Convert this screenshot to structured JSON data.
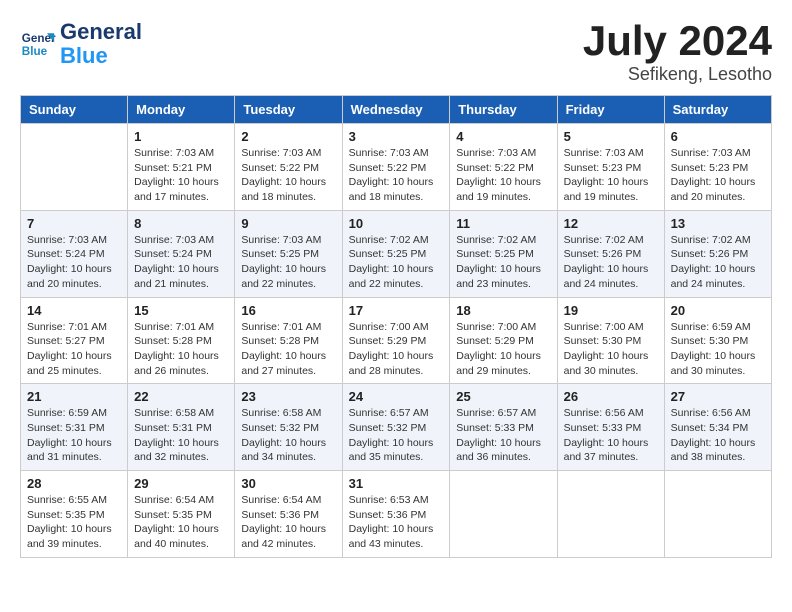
{
  "logo": {
    "name": "General",
    "name2": "Blue"
  },
  "header": {
    "month": "July 2024",
    "location": "Sefikeng, Lesotho"
  },
  "columns": [
    "Sunday",
    "Monday",
    "Tuesday",
    "Wednesday",
    "Thursday",
    "Friday",
    "Saturday"
  ],
  "weeks": [
    [
      {
        "day": "",
        "sunrise": "",
        "sunset": "",
        "daylight": ""
      },
      {
        "day": "1",
        "sunrise": "Sunrise: 7:03 AM",
        "sunset": "Sunset: 5:21 PM",
        "daylight": "Daylight: 10 hours and 17 minutes."
      },
      {
        "day": "2",
        "sunrise": "Sunrise: 7:03 AM",
        "sunset": "Sunset: 5:22 PM",
        "daylight": "Daylight: 10 hours and 18 minutes."
      },
      {
        "day": "3",
        "sunrise": "Sunrise: 7:03 AM",
        "sunset": "Sunset: 5:22 PM",
        "daylight": "Daylight: 10 hours and 18 minutes."
      },
      {
        "day": "4",
        "sunrise": "Sunrise: 7:03 AM",
        "sunset": "Sunset: 5:22 PM",
        "daylight": "Daylight: 10 hours and 19 minutes."
      },
      {
        "day": "5",
        "sunrise": "Sunrise: 7:03 AM",
        "sunset": "Sunset: 5:23 PM",
        "daylight": "Daylight: 10 hours and 19 minutes."
      },
      {
        "day": "6",
        "sunrise": "Sunrise: 7:03 AM",
        "sunset": "Sunset: 5:23 PM",
        "daylight": "Daylight: 10 hours and 20 minutes."
      }
    ],
    [
      {
        "day": "7",
        "sunrise": "Sunrise: 7:03 AM",
        "sunset": "Sunset: 5:24 PM",
        "daylight": "Daylight: 10 hours and 20 minutes."
      },
      {
        "day": "8",
        "sunrise": "Sunrise: 7:03 AM",
        "sunset": "Sunset: 5:24 PM",
        "daylight": "Daylight: 10 hours and 21 minutes."
      },
      {
        "day": "9",
        "sunrise": "Sunrise: 7:03 AM",
        "sunset": "Sunset: 5:25 PM",
        "daylight": "Daylight: 10 hours and 22 minutes."
      },
      {
        "day": "10",
        "sunrise": "Sunrise: 7:02 AM",
        "sunset": "Sunset: 5:25 PM",
        "daylight": "Daylight: 10 hours and 22 minutes."
      },
      {
        "day": "11",
        "sunrise": "Sunrise: 7:02 AM",
        "sunset": "Sunset: 5:25 PM",
        "daylight": "Daylight: 10 hours and 23 minutes."
      },
      {
        "day": "12",
        "sunrise": "Sunrise: 7:02 AM",
        "sunset": "Sunset: 5:26 PM",
        "daylight": "Daylight: 10 hours and 24 minutes."
      },
      {
        "day": "13",
        "sunrise": "Sunrise: 7:02 AM",
        "sunset": "Sunset: 5:26 PM",
        "daylight": "Daylight: 10 hours and 24 minutes."
      }
    ],
    [
      {
        "day": "14",
        "sunrise": "Sunrise: 7:01 AM",
        "sunset": "Sunset: 5:27 PM",
        "daylight": "Daylight: 10 hours and 25 minutes."
      },
      {
        "day": "15",
        "sunrise": "Sunrise: 7:01 AM",
        "sunset": "Sunset: 5:28 PM",
        "daylight": "Daylight: 10 hours and 26 minutes."
      },
      {
        "day": "16",
        "sunrise": "Sunrise: 7:01 AM",
        "sunset": "Sunset: 5:28 PM",
        "daylight": "Daylight: 10 hours and 27 minutes."
      },
      {
        "day": "17",
        "sunrise": "Sunrise: 7:00 AM",
        "sunset": "Sunset: 5:29 PM",
        "daylight": "Daylight: 10 hours and 28 minutes."
      },
      {
        "day": "18",
        "sunrise": "Sunrise: 7:00 AM",
        "sunset": "Sunset: 5:29 PM",
        "daylight": "Daylight: 10 hours and 29 minutes."
      },
      {
        "day": "19",
        "sunrise": "Sunrise: 7:00 AM",
        "sunset": "Sunset: 5:30 PM",
        "daylight": "Daylight: 10 hours and 30 minutes."
      },
      {
        "day": "20",
        "sunrise": "Sunrise: 6:59 AM",
        "sunset": "Sunset: 5:30 PM",
        "daylight": "Daylight: 10 hours and 30 minutes."
      }
    ],
    [
      {
        "day": "21",
        "sunrise": "Sunrise: 6:59 AM",
        "sunset": "Sunset: 5:31 PM",
        "daylight": "Daylight: 10 hours and 31 minutes."
      },
      {
        "day": "22",
        "sunrise": "Sunrise: 6:58 AM",
        "sunset": "Sunset: 5:31 PM",
        "daylight": "Daylight: 10 hours and 32 minutes."
      },
      {
        "day": "23",
        "sunrise": "Sunrise: 6:58 AM",
        "sunset": "Sunset: 5:32 PM",
        "daylight": "Daylight: 10 hours and 34 minutes."
      },
      {
        "day": "24",
        "sunrise": "Sunrise: 6:57 AM",
        "sunset": "Sunset: 5:32 PM",
        "daylight": "Daylight: 10 hours and 35 minutes."
      },
      {
        "day": "25",
        "sunrise": "Sunrise: 6:57 AM",
        "sunset": "Sunset: 5:33 PM",
        "daylight": "Daylight: 10 hours and 36 minutes."
      },
      {
        "day": "26",
        "sunrise": "Sunrise: 6:56 AM",
        "sunset": "Sunset: 5:33 PM",
        "daylight": "Daylight: 10 hours and 37 minutes."
      },
      {
        "day": "27",
        "sunrise": "Sunrise: 6:56 AM",
        "sunset": "Sunset: 5:34 PM",
        "daylight": "Daylight: 10 hours and 38 minutes."
      }
    ],
    [
      {
        "day": "28",
        "sunrise": "Sunrise: 6:55 AM",
        "sunset": "Sunset: 5:35 PM",
        "daylight": "Daylight: 10 hours and 39 minutes."
      },
      {
        "day": "29",
        "sunrise": "Sunrise: 6:54 AM",
        "sunset": "Sunset: 5:35 PM",
        "daylight": "Daylight: 10 hours and 40 minutes."
      },
      {
        "day": "30",
        "sunrise": "Sunrise: 6:54 AM",
        "sunset": "Sunset: 5:36 PM",
        "daylight": "Daylight: 10 hours and 42 minutes."
      },
      {
        "day": "31",
        "sunrise": "Sunrise: 6:53 AM",
        "sunset": "Sunset: 5:36 PM",
        "daylight": "Daylight: 10 hours and 43 minutes."
      },
      {
        "day": "",
        "sunrise": "",
        "sunset": "",
        "daylight": ""
      },
      {
        "day": "",
        "sunrise": "",
        "sunset": "",
        "daylight": ""
      },
      {
        "day": "",
        "sunrise": "",
        "sunset": "",
        "daylight": ""
      }
    ]
  ]
}
